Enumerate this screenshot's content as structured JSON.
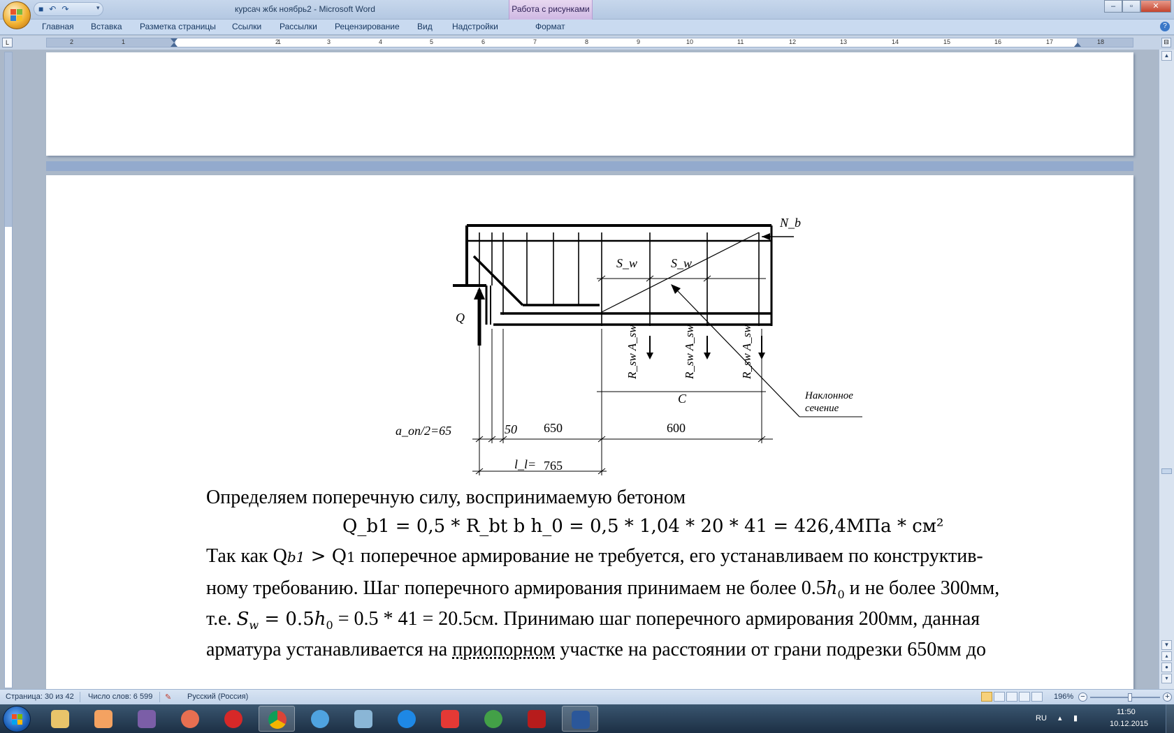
{
  "window": {
    "title": "курсач жбк ноябрь2 - Microsoft Word",
    "context_tab_title": "Работа с рисунками"
  },
  "ribbon": {
    "tabs": [
      "Главная",
      "Вставка",
      "Разметка страницы",
      "Ссылки",
      "Рассылки",
      "Рецензирование",
      "Вид",
      "Надстройки",
      "Формат"
    ]
  },
  "ruler": {
    "numbers": [
      "2",
      "1",
      "1",
      "2",
      "3",
      "4",
      "5",
      "6",
      "7",
      "8",
      "9",
      "10",
      "11",
      "12",
      "13",
      "14",
      "15",
      "16",
      "17",
      "18"
    ]
  },
  "diagram": {
    "labels": {
      "nb": "N_b",
      "sw1": "S_w",
      "sw2": "S_w",
      "q": "Q",
      "rsw1": "R_sw A_sw",
      "rsw2": "R_sw A_sw",
      "rsw3": "R_sw A_sw",
      "c": "C",
      "inclined_1": "Наклонное",
      "inclined_2": "сечение",
      "aon": "a_on/2=65",
      "d50": "50",
      "d650": "650",
      "d600": "600",
      "l1": "l_l=",
      "d765": "765"
    }
  },
  "document": {
    "line1": "Определяем поперечную силу, воспринимаемую бетоном",
    "formula1": "Q_b1 = 0,5 * R_bt b h_0 = 0,5 * 1,04 * 20 * 41 = 426,4МПа * см²",
    "line3_a": "Так как Q",
    "line3_b": " поперечное армирование не требуется, его устанавливаем по конструктив-",
    "line4_a": "ному требованию. Шаг поперечного армирования принимаем не более 0.5",
    "line4_b": " и не более 300мм,",
    "line5_a": "т.е. ",
    "line5_b": " = 0.5 * 41 = 20.5см. Принимаю шаг поперечного армирования 200мм, данная",
    "line6_a": "арматура устанавливается на ",
    "line6_b": "приопорном",
    "line6_c": " участке на расстоянии  от грани подрезки 650мм до"
  },
  "status": {
    "page": "Страница: 30 из 42",
    "words": "Число слов: 6 599",
    "language": "Русский (Россия)",
    "zoom": "196%"
  },
  "taskbar": {
    "apps": [
      "explorer",
      "media-player",
      "visual-studio",
      "firefox",
      "opera",
      "chrome",
      "aimp",
      "volume",
      "internet-explorer",
      "yandex",
      "utorrent",
      "acrobat",
      "word"
    ],
    "lang": "RU",
    "time": "11:50",
    "date": "10.12.2015"
  },
  "colors": {
    "ribbon_bg": "#c9daf0",
    "context_tab": "#cfb8e3",
    "page_bg": "#ffffff",
    "workspace_bg": "#abb8c9"
  }
}
